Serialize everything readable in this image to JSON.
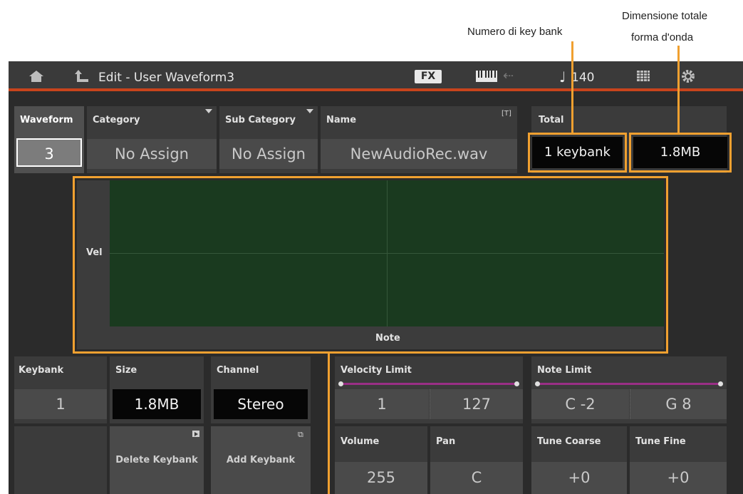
{
  "callouts": {
    "keybank_number": "Numero di key bank",
    "total_size_line1": "Dimensione totale",
    "total_size_line2": "forma d'onda"
  },
  "header": {
    "title": "Edit - User Waveform3",
    "fx_label": "FX",
    "tempo": "140"
  },
  "fields": {
    "waveform": {
      "label": "Waveform",
      "value": "3"
    },
    "category": {
      "label": "Category",
      "value": "No Assign"
    },
    "sub_category": {
      "label": "Sub Category",
      "value": "No Assign"
    },
    "name": {
      "label": "Name",
      "value": "NewAudioRec.wav",
      "text_icon": "[T]"
    },
    "total": {
      "label": "Total",
      "keybanks": "1 keybank",
      "size": "1.8MB"
    }
  },
  "map": {
    "y_label": "Vel",
    "x_label": "Note"
  },
  "keybank": {
    "keybank": {
      "label": "Keybank",
      "value": "1"
    },
    "size": {
      "label": "Size",
      "value": "1.8MB"
    },
    "channel": {
      "label": "Channel",
      "value": "Stereo"
    },
    "delete_label": "Delete Keybank",
    "add_label": "Add Keybank"
  },
  "limits": {
    "velocity": {
      "label": "Velocity Limit",
      "low": "1",
      "high": "127"
    },
    "note": {
      "label": "Note Limit",
      "low": "C -2",
      "high": "G 8"
    }
  },
  "params": {
    "volume": {
      "label": "Volume",
      "value": "255"
    },
    "pan": {
      "label": "Pan",
      "value": "C"
    },
    "tune_coarse": {
      "label": "Tune Coarse",
      "value": "+0"
    },
    "tune_fine": {
      "label": "Tune Fine",
      "value": "+0"
    }
  },
  "colors": {
    "accent": "#f0a030",
    "header_stripe": "#c8441c",
    "map_fill": "#1a3a1f",
    "slider": "#9a2f86"
  }
}
